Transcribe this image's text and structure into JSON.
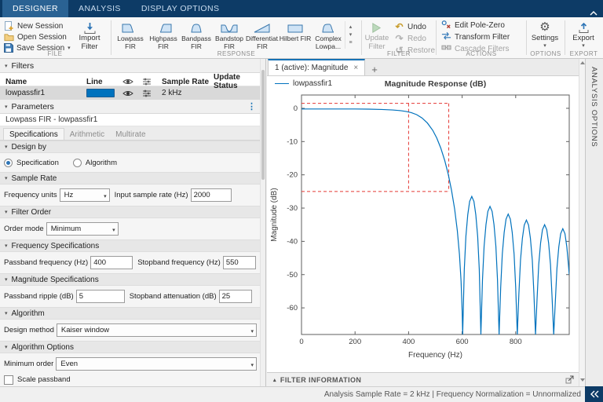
{
  "icons": {
    "caret_down": "▾",
    "tri_down": "▾",
    "tri_up": "▴",
    "dots_v": "⋮",
    "close": "×",
    "plus": "+",
    "undo": "↶",
    "redo": "↷",
    "restore": "↺",
    "gear": "⚙",
    "menu": "≡"
  },
  "tabs": {
    "designer": "DESIGNER",
    "analysis": "ANALYSIS",
    "display_options": "DISPLAY OPTIONS"
  },
  "ribbon": {
    "file": {
      "label": "FILE",
      "new_session": "New Session",
      "open_session": "Open Session",
      "save_session": "Save Session",
      "import_l1": "Import",
      "import_l2": "Filter"
    },
    "response": {
      "label": "RESPONSE",
      "items": [
        {
          "l1": "Lowpass",
          "l2": "FIR"
        },
        {
          "l1": "Highpass",
          "l2": "FIR"
        },
        {
          "l1": "Bandpass",
          "l2": "FIR"
        },
        {
          "l1": "Bandstop",
          "l2": "FIR"
        },
        {
          "l1": "Differentiat...",
          "l2": "FIR"
        },
        {
          "l1": "Hilbert FIR",
          "l2": ""
        },
        {
          "l1": "Complex",
          "l2": "Lowpa..."
        }
      ]
    },
    "filter": {
      "label": "FILTER",
      "update_l1": "Update",
      "update_l2": "Filter",
      "undo": "Undo",
      "redo": "Redo",
      "restore": "Restore"
    },
    "actions": {
      "label": "ACTIONS",
      "edit_pole_zero": "Edit Pole-Zero",
      "transform_filter": "Transform Filter",
      "cascade_filters": "Cascade Filters"
    },
    "options": {
      "label": "OPTIONS",
      "settings": "Settings"
    },
    "export": {
      "label": "EXPORT",
      "export": "Export"
    }
  },
  "filters_panel": {
    "title": "Filters",
    "col_name": "Name",
    "col_line": "Line",
    "col_sample_rate": "Sample Rate",
    "col_update_status": "Update Status",
    "row": {
      "name": "lowpassfir1",
      "sample_rate": "2 kHz"
    }
  },
  "parameters": {
    "title": "Parameters",
    "subtitle": "Lowpass FIR - lowpassfir1",
    "tabs": [
      "Specifications",
      "Arithmetic",
      "Multirate"
    ],
    "design_by": {
      "header": "Design by",
      "radio1": "Specification",
      "radio2": "Algorithm"
    },
    "sample_rate": {
      "header": "Sample Rate",
      "freq_units_label": "Frequency units",
      "freq_units_value": "Hz",
      "input_rate_label": "Input sample rate (Hz)",
      "input_rate_value": "2000"
    },
    "filter_order": {
      "header": "Filter Order",
      "order_mode_label": "Order mode",
      "order_mode_value": "Minimum"
    },
    "freq_specs": {
      "header": "Frequency Specifications",
      "passband_label": "Passband frequency (Hz)",
      "passband_value": "400",
      "stopband_label": "Stopband frequency (Hz)",
      "stopband_value": "550"
    },
    "mag_specs": {
      "header": "Magnitude Specifications",
      "ripple_label": "Passband ripple (dB)",
      "ripple_value": "5",
      "atten_label": "Stopband attenuation (dB)",
      "atten_value": "25"
    },
    "algorithm": {
      "header": "Algorithm",
      "design_method_label": "Design method",
      "design_method_value": "Kaiser window"
    },
    "algorithm_options": {
      "header": "Algorithm Options",
      "min_order_label": "Minimum order",
      "min_order_value": "Even",
      "scale_passband": "Scale passband"
    }
  },
  "figure": {
    "tab_title": "1 (active): Magnitude",
    "legend": "lowpassfir1",
    "filter_info": "FILTER INFORMATION"
  },
  "status_bar": {
    "text": "Analysis Sample Rate = 2 kHz | Frequency Normalization = Unnormalized"
  },
  "analysis_strip": {
    "label": "ANALYSIS OPTIONS"
  },
  "colors": {
    "accent": "#0072BD",
    "mask": "#E53935",
    "tab_bar": "#0D3B66"
  },
  "chart_data": {
    "type": "line",
    "title": "Magnitude Response (dB)",
    "xlabel": "Frequency (Hz)",
    "ylabel": "Magnitude (dB)",
    "xlim": [
      0,
      1000
    ],
    "ylim": [
      -68,
      4
    ],
    "xticks": [
      0,
      200,
      400,
      600,
      800
    ],
    "yticks": [
      0,
      -10,
      -20,
      -30,
      -40,
      -50,
      -60
    ],
    "grid": false,
    "legend_position": "top-left-outside",
    "series": [
      {
        "name": "lowpassfir1",
        "color": "#0072BD",
        "x": [
          0,
          50,
          100,
          150,
          200,
          250,
          300,
          340,
          370,
          390,
          410,
          430,
          450,
          470,
          490,
          505,
          520,
          535,
          548,
          560,
          572,
          582,
          590,
          596,
          600,
          602,
          608,
          614,
          621,
          628,
          636,
          644,
          651,
          658,
          664,
          670,
          676,
          682,
          689,
          696,
          704,
          712,
          719,
          726,
          732,
          738,
          744,
          750,
          757,
          764,
          772,
          780,
          787,
          794,
          800,
          806,
          812,
          818,
          825,
          832,
          840,
          848,
          855,
          862,
          868,
          874,
          880,
          886,
          893,
          900,
          908,
          916,
          923,
          930,
          936,
          942,
          948,
          954,
          961,
          968,
          976,
          984,
          991,
          997,
          1000
        ],
        "y": [
          -0.2,
          -0.2,
          -0.2,
          -0.2,
          -0.2,
          -0.25,
          -0.35,
          -0.5,
          -0.7,
          -0.95,
          -1.3,
          -1.9,
          -2.9,
          -4.4,
          -6.6,
          -8.9,
          -11.9,
          -15.7,
          -19.8,
          -24.5,
          -30.3,
          -36.8,
          -44,
          -52,
          -61,
          -68,
          -48.5,
          -38.5,
          -32,
          -28,
          -26.5,
          -28,
          -32,
          -38.5,
          -48.5,
          -68,
          -51.5,
          -41.5,
          -35,
          -31,
          -29.5,
          -31,
          -35,
          -41.5,
          -51.5,
          -68,
          -53.8,
          -43.8,
          -37.3,
          -33.3,
          -31.8,
          -33.3,
          -37.3,
          -43.8,
          -53.8,
          -68,
          -55.6,
          -45.6,
          -39.1,
          -35.1,
          -33.6,
          -35.1,
          -39.1,
          -45.6,
          -55.6,
          -68,
          -57,
          -47,
          -40.5,
          -36.5,
          -35,
          -36.5,
          -40.5,
          -47,
          -57,
          -68,
          -58.2,
          -48.2,
          -41.7,
          -37.7,
          -36.2,
          -37.7,
          -41.7,
          -47,
          -50
        ]
      }
    ],
    "mask": {
      "name": "design specification mask",
      "color": "#E53935",
      "dashed": true,
      "segments": [
        [
          [
            0,
            1.5
          ],
          [
            550,
            1.5
          ]
        ],
        [
          [
            550,
            1.5
          ],
          [
            550,
            -25
          ]
        ],
        [
          [
            0,
            -25
          ],
          [
            550,
            -25
          ]
        ],
        [
          [
            400,
            1.5
          ],
          [
            400,
            -25
          ]
        ]
      ]
    }
  }
}
